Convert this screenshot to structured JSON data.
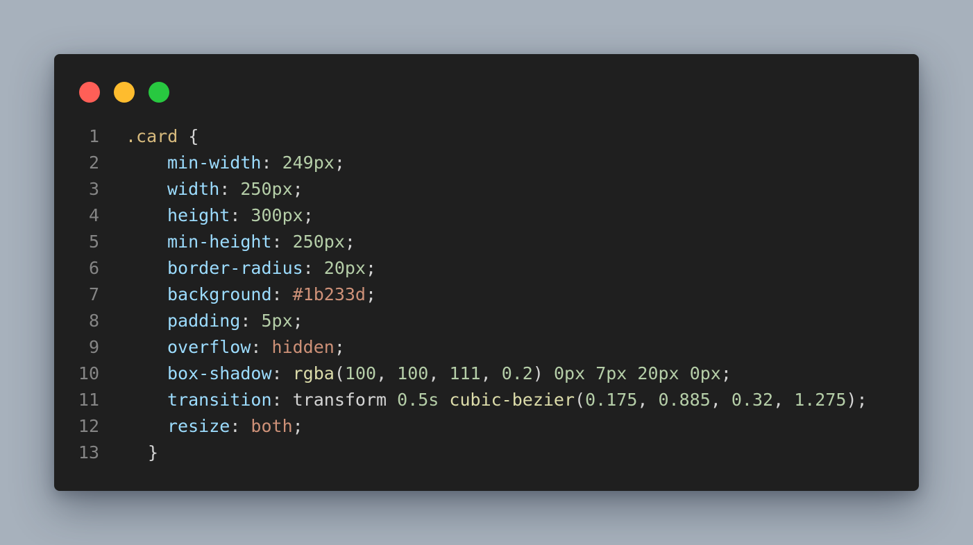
{
  "window": {
    "controls": [
      {
        "name": "close",
        "color": "#ff5f57"
      },
      {
        "name": "minimize",
        "color": "#febc2e"
      },
      {
        "name": "zoom",
        "color": "#28c840"
      }
    ]
  },
  "code": {
    "lines": [
      {
        "number": "1",
        "tokens": [
          {
            "type": "selector",
            "text": ".card"
          },
          {
            "type": "plain",
            "text": " "
          },
          {
            "type": "brace",
            "text": "{"
          }
        ]
      },
      {
        "number": "2",
        "tokens": [
          {
            "type": "prop",
            "text": "min-width"
          },
          {
            "type": "punct",
            "text": ": "
          },
          {
            "type": "num",
            "text": "249px"
          },
          {
            "type": "punct",
            "text": ";"
          }
        ]
      },
      {
        "number": "3",
        "tokens": [
          {
            "type": "prop",
            "text": "width"
          },
          {
            "type": "punct",
            "text": ": "
          },
          {
            "type": "num",
            "text": "250px"
          },
          {
            "type": "punct",
            "text": ";"
          }
        ]
      },
      {
        "number": "4",
        "tokens": [
          {
            "type": "prop",
            "text": "height"
          },
          {
            "type": "punct",
            "text": ": "
          },
          {
            "type": "num",
            "text": "300px"
          },
          {
            "type": "punct",
            "text": ";"
          }
        ]
      },
      {
        "number": "5",
        "tokens": [
          {
            "type": "prop",
            "text": "min-height"
          },
          {
            "type": "punct",
            "text": ": "
          },
          {
            "type": "num",
            "text": "250px"
          },
          {
            "type": "punct",
            "text": ";"
          }
        ]
      },
      {
        "number": "6",
        "tokens": [
          {
            "type": "prop",
            "text": "border-radius"
          },
          {
            "type": "punct",
            "text": ": "
          },
          {
            "type": "num",
            "text": "20px"
          },
          {
            "type": "punct",
            "text": ";"
          }
        ]
      },
      {
        "number": "7",
        "tokens": [
          {
            "type": "prop",
            "text": "background"
          },
          {
            "type": "punct",
            "text": ": "
          },
          {
            "type": "str",
            "text": "#1b233d"
          },
          {
            "type": "punct",
            "text": ";"
          }
        ]
      },
      {
        "number": "8",
        "tokens": [
          {
            "type": "prop",
            "text": "padding"
          },
          {
            "type": "punct",
            "text": ": "
          },
          {
            "type": "num",
            "text": "5px"
          },
          {
            "type": "punct",
            "text": ";"
          }
        ]
      },
      {
        "number": "9",
        "tokens": [
          {
            "type": "prop",
            "text": "overflow"
          },
          {
            "type": "punct",
            "text": ": "
          },
          {
            "type": "str",
            "text": "hidden"
          },
          {
            "type": "punct",
            "text": ";"
          }
        ]
      },
      {
        "number": "10",
        "tokens": [
          {
            "type": "prop",
            "text": "box-shadow"
          },
          {
            "type": "punct",
            "text": ": "
          },
          {
            "type": "fn",
            "text": "rgba"
          },
          {
            "type": "punct",
            "text": "("
          },
          {
            "type": "num",
            "text": "100"
          },
          {
            "type": "punct",
            "text": ", "
          },
          {
            "type": "num",
            "text": "100"
          },
          {
            "type": "punct",
            "text": ", "
          },
          {
            "type": "num",
            "text": "111"
          },
          {
            "type": "punct",
            "text": ", "
          },
          {
            "type": "num",
            "text": "0.2"
          },
          {
            "type": "punct",
            "text": ") "
          },
          {
            "type": "num",
            "text": "0px"
          },
          {
            "type": "plain",
            "text": " "
          },
          {
            "type": "num",
            "text": "7px"
          },
          {
            "type": "plain",
            "text": " "
          },
          {
            "type": "num",
            "text": "20px"
          },
          {
            "type": "plain",
            "text": " "
          },
          {
            "type": "num",
            "text": "0px"
          },
          {
            "type": "punct",
            "text": ";"
          }
        ]
      },
      {
        "number": "11",
        "tokens": [
          {
            "type": "prop",
            "text": "transition"
          },
          {
            "type": "punct",
            "text": ": "
          },
          {
            "type": "plain",
            "text": "transform "
          },
          {
            "type": "num",
            "text": "0.5s"
          },
          {
            "type": "plain",
            "text": " "
          },
          {
            "type": "fn",
            "text": "cubic-bezier"
          },
          {
            "type": "punct",
            "text": "("
          },
          {
            "type": "num",
            "text": "0.175"
          },
          {
            "type": "punct",
            "text": ", "
          },
          {
            "type": "num",
            "text": "0.885"
          },
          {
            "type": "punct",
            "text": ", "
          },
          {
            "type": "num",
            "text": "0.32"
          },
          {
            "type": "punct",
            "text": ", "
          },
          {
            "type": "num",
            "text": "1.275"
          },
          {
            "type": "punct",
            "text": ");"
          }
        ]
      },
      {
        "number": "12",
        "tokens": [
          {
            "type": "prop",
            "text": "resize"
          },
          {
            "type": "punct",
            "text": ": "
          },
          {
            "type": "str",
            "text": "both"
          },
          {
            "type": "punct",
            "text": ";"
          }
        ]
      },
      {
        "number": "13",
        "tokens": [
          {
            "type": "brace",
            "text": "}"
          }
        ]
      }
    ]
  }
}
